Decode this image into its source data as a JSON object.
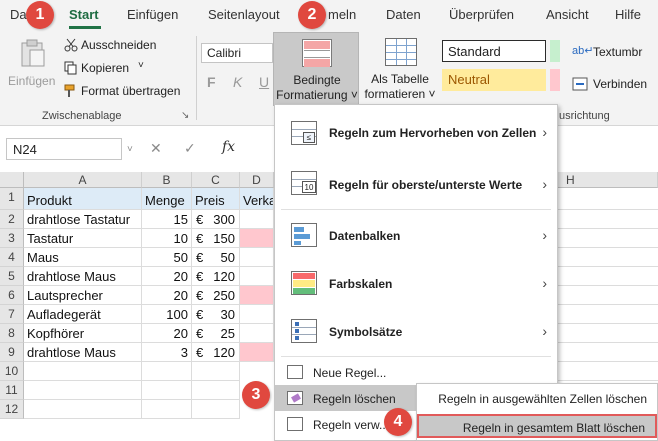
{
  "ribbon_tabs": [
    "Da",
    "Start",
    "Einfügen",
    "Seitenlayout",
    "meln",
    "Daten",
    "Überprüfen",
    "Ansicht",
    "Hilfe"
  ],
  "clipboard": {
    "paste_label": "Einfügen",
    "cut_label": "Ausschneiden",
    "copy_label": "Kopieren",
    "format_painter_label": "Format übertragen",
    "group_label": "Zwischenablage"
  },
  "font": {
    "name": "Calibri",
    "bold": "F",
    "italic": "K",
    "underline": "U"
  },
  "conditional_formatting": {
    "line1": "Bedingte",
    "line2": "Formatierung ˅"
  },
  "format_as_table": {
    "line1": "Als Tabelle",
    "line2": "formatieren ˅"
  },
  "styles": {
    "standard": "Standard",
    "neutral": "Neutral"
  },
  "alignment": {
    "wrap_text": "Textumbr",
    "merge": "Verbinden",
    "group_label": "usrichtung"
  },
  "formula_bar": {
    "name_box": "N24",
    "fx": "fx",
    "cancel": "✕",
    "confirm": "✓"
  },
  "grid": {
    "columns": [
      "A",
      "B",
      "C",
      "D",
      "H"
    ],
    "row_numbers": [
      "1",
      "2",
      "3",
      "4",
      "5",
      "6",
      "7",
      "8",
      "9",
      "10",
      "11",
      "12"
    ],
    "header_row": [
      "Produkt",
      "Menge",
      "Preis",
      "Verka"
    ],
    "currency": "€",
    "rows": [
      {
        "product": "drahtlose Tastatur",
        "qty": "15",
        "price": "300"
      },
      {
        "product": "Tastatur",
        "qty": "10",
        "price": "150"
      },
      {
        "product": "Maus",
        "qty": "50",
        "price": "50"
      },
      {
        "product": "drahtlose Maus",
        "qty": "20",
        "price": "120"
      },
      {
        "product": "Lautsprecher",
        "qty": "20",
        "price": "250"
      },
      {
        "product": "Aufladegerät",
        "qty": "100",
        "price": "30"
      },
      {
        "product": "Kopfhörer",
        "qty": "20",
        "price": "25"
      },
      {
        "product": "drahtlose Maus",
        "qty": "3",
        "price": "120"
      }
    ]
  },
  "menu": {
    "items": [
      "Regeln zum Hervorheben von Zellen",
      "Regeln für oberste/unterste Werte",
      "Datenbalken",
      "Farbskalen",
      "Symbolsätze",
      "Neue Regel...",
      "Regeln löschen",
      "Regeln verw..."
    ],
    "submenu": [
      "Regeln in ausgewählten Zellen löschen",
      "Regeln in gesamtem Blatt löschen"
    ]
  },
  "badges": [
    "1",
    "2",
    "3",
    "4"
  ],
  "colors": {
    "accent": "#217346",
    "badge": "#e0483f",
    "header_fill": "#ddebf7",
    "pink_fill": "#ffc7ce",
    "neutral_fill": "#ffeb9c"
  }
}
